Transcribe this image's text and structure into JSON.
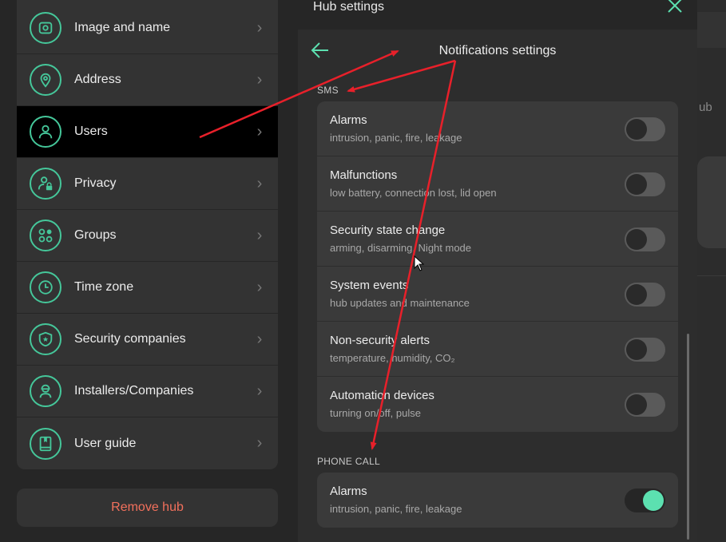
{
  "window": {
    "title": "Hub settings"
  },
  "background": {
    "partial_text": "ub"
  },
  "menu": {
    "items": [
      {
        "label": "Image and name",
        "icon": "image-icon"
      },
      {
        "label": "Address",
        "icon": "location-pin-icon"
      },
      {
        "label": "Users",
        "icon": "user-icon",
        "active": true
      },
      {
        "label": "Privacy",
        "icon": "user-lock-icon"
      },
      {
        "label": "Groups",
        "icon": "groups-icon"
      },
      {
        "label": "Time zone",
        "icon": "clock-icon"
      },
      {
        "label": "Security companies",
        "icon": "shield-star-icon"
      },
      {
        "label": "Installers/Companies",
        "icon": "installer-icon"
      },
      {
        "label": "User guide",
        "icon": "book-icon"
      }
    ],
    "remove_label": "Remove hub"
  },
  "notifications": {
    "title": "Notifications settings",
    "sms_label": "SMS",
    "sms_rows": [
      {
        "title": "Alarms",
        "subtitle": "intrusion, panic, fire, leakage",
        "enabled": false
      },
      {
        "title": "Malfunctions",
        "subtitle": "low battery, connection lost, lid open",
        "enabled": false
      },
      {
        "title": "Security state change",
        "subtitle": "arming, disarming, Night mode",
        "enabled": false
      },
      {
        "title": "System events",
        "subtitle": "hub updates and maintenance",
        "enabled": false
      },
      {
        "title": "Non-security alerts",
        "subtitle": "temperature, humidity, CO₂",
        "enabled": false
      },
      {
        "title": "Automation devices",
        "subtitle": "turning on/off, pulse",
        "enabled": false
      }
    ],
    "phone_label": "PHONE CALL",
    "phone_rows": [
      {
        "title": "Alarms",
        "subtitle": "intrusion, panic, fire, leakage",
        "enabled": true
      }
    ]
  },
  "colors": {
    "accent": "#5ce0b0",
    "danger": "#f2705c",
    "annotation": "#e8202a",
    "active_row": "#000000"
  }
}
